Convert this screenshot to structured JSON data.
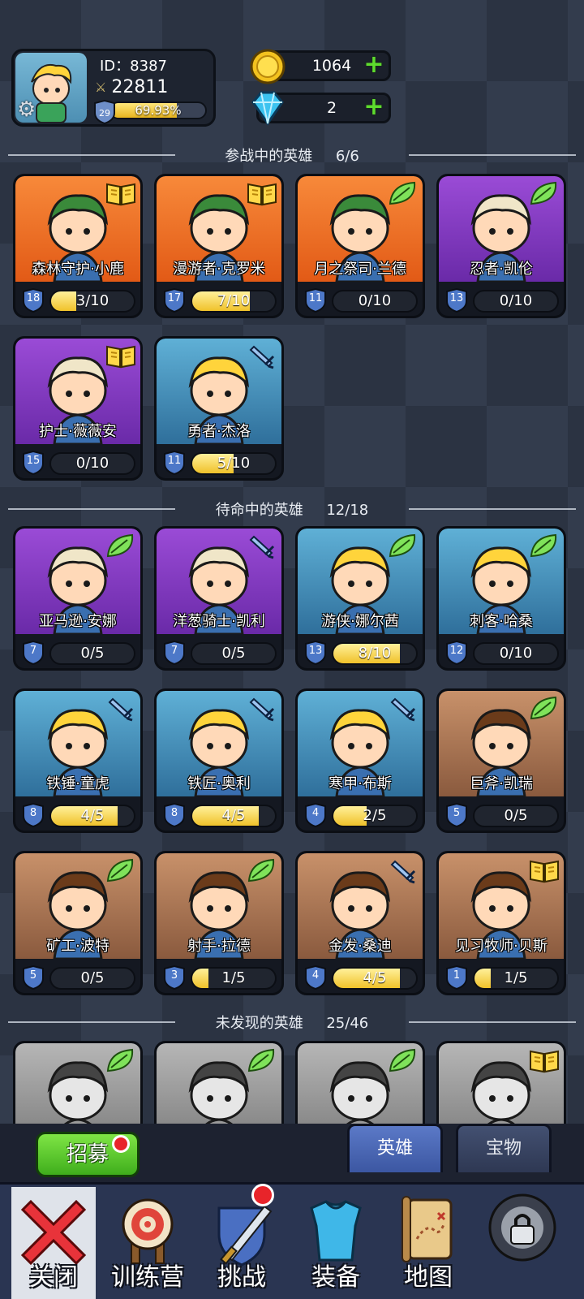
{
  "profile": {
    "id_text": "ID：8387",
    "power": "22811",
    "level": "29",
    "xp_percent_text": "69.93%",
    "xp_fraction": 0.6993
  },
  "currency": {
    "gold": "1064",
    "diamonds": "2"
  },
  "sections": {
    "active": {
      "title": "参战中的英雄",
      "count": "6/6"
    },
    "standby": {
      "title": "待命中的英雄",
      "count": "12/18"
    },
    "undiscovered": {
      "title": "未发现的英雄",
      "count": "25/46"
    }
  },
  "heroes_active": [
    {
      "name": "森林守护·小鹿",
      "level": "18",
      "progress": "3/10",
      "fraction": 0.3,
      "bg": "orange",
      "badge": "book-icon"
    },
    {
      "name": "漫游者·克罗米",
      "level": "17",
      "progress": "7/10",
      "fraction": 0.7,
      "bg": "orange",
      "badge": "book-icon"
    },
    {
      "name": "月之祭司·兰德",
      "level": "11",
      "progress": "0/10",
      "fraction": 0.0,
      "bg": "orange",
      "badge": "leaf-icon"
    },
    {
      "name": "忍者·凯伦",
      "level": "13",
      "progress": "0/10",
      "fraction": 0.0,
      "bg": "purple",
      "badge": "leaf-icon"
    },
    {
      "name": "护士·薇薇安",
      "level": "15",
      "progress": "0/10",
      "fraction": 0.0,
      "bg": "purple",
      "badge": "book-icon"
    },
    {
      "name": "勇者·杰洛",
      "level": "11",
      "progress": "5/10",
      "fraction": 0.5,
      "bg": "blue",
      "badge": "sword-icon"
    }
  ],
  "heroes_standby": [
    {
      "name": "亚马逊·安娜",
      "level": "7",
      "progress": "0/5",
      "fraction": 0.0,
      "bg": "purple",
      "badge": "leaf-icon"
    },
    {
      "name": "洋葱骑士·凯利",
      "level": "7",
      "progress": "0/5",
      "fraction": 0.0,
      "bg": "purple",
      "badge": "sword-icon"
    },
    {
      "name": "游侠·娜尔茜",
      "level": "13",
      "progress": "8/10",
      "fraction": 0.8,
      "bg": "blue",
      "badge": "leaf-icon"
    },
    {
      "name": "刺客·哈桑",
      "level": "12",
      "progress": "0/10",
      "fraction": 0.0,
      "bg": "blue",
      "badge": "leaf-icon"
    },
    {
      "name": "铁锤·童虎",
      "level": "8",
      "progress": "4/5",
      "fraction": 0.8,
      "bg": "blue",
      "badge": "sword-icon"
    },
    {
      "name": "铁匠·奥利",
      "level": "8",
      "progress": "4/5",
      "fraction": 0.8,
      "bg": "blue",
      "badge": "sword-icon"
    },
    {
      "name": "寒甲·布斯",
      "level": "4",
      "progress": "2/5",
      "fraction": 0.4,
      "bg": "blue",
      "badge": "sword-icon"
    },
    {
      "name": "巨斧·凯瑞",
      "level": "5",
      "progress": "0/5",
      "fraction": 0.0,
      "bg": "brown",
      "badge": "leaf-icon"
    },
    {
      "name": "矿工·波特",
      "level": "5",
      "progress": "0/5",
      "fraction": 0.0,
      "bg": "brown",
      "badge": "leaf-icon"
    },
    {
      "name": "射手·拉德",
      "level": "3",
      "progress": "1/5",
      "fraction": 0.2,
      "bg": "brown",
      "badge": "leaf-icon"
    },
    {
      "name": "金发·桑迪",
      "level": "4",
      "progress": "4/5",
      "fraction": 0.8,
      "bg": "brown",
      "badge": "sword-icon"
    },
    {
      "name": "见习牧师·贝斯",
      "level": "1",
      "progress": "1/5",
      "fraction": 0.2,
      "bg": "brown",
      "badge": "book-icon"
    }
  ],
  "heroes_undiscovered": [
    {
      "bg": "gray",
      "badge": "leaf-icon"
    },
    {
      "bg": "gray",
      "badge": "leaf-icon"
    },
    {
      "bg": "gray",
      "badge": "leaf-icon"
    },
    {
      "bg": "gray",
      "badge": "book-icon"
    }
  ],
  "actions": {
    "recruit": "招募",
    "tab_heroes": "英雄",
    "tab_treasure": "宝物"
  },
  "nav": [
    {
      "label": "关闭",
      "icon": "close-icon"
    },
    {
      "label": "训练营",
      "icon": "target-icon"
    },
    {
      "label": "挑战",
      "icon": "sword-shield-icon"
    },
    {
      "label": "装备",
      "icon": "armor-icon"
    },
    {
      "label": "地图",
      "icon": "map-icon"
    },
    {
      "label": "",
      "icon": "locked-icon"
    }
  ]
}
